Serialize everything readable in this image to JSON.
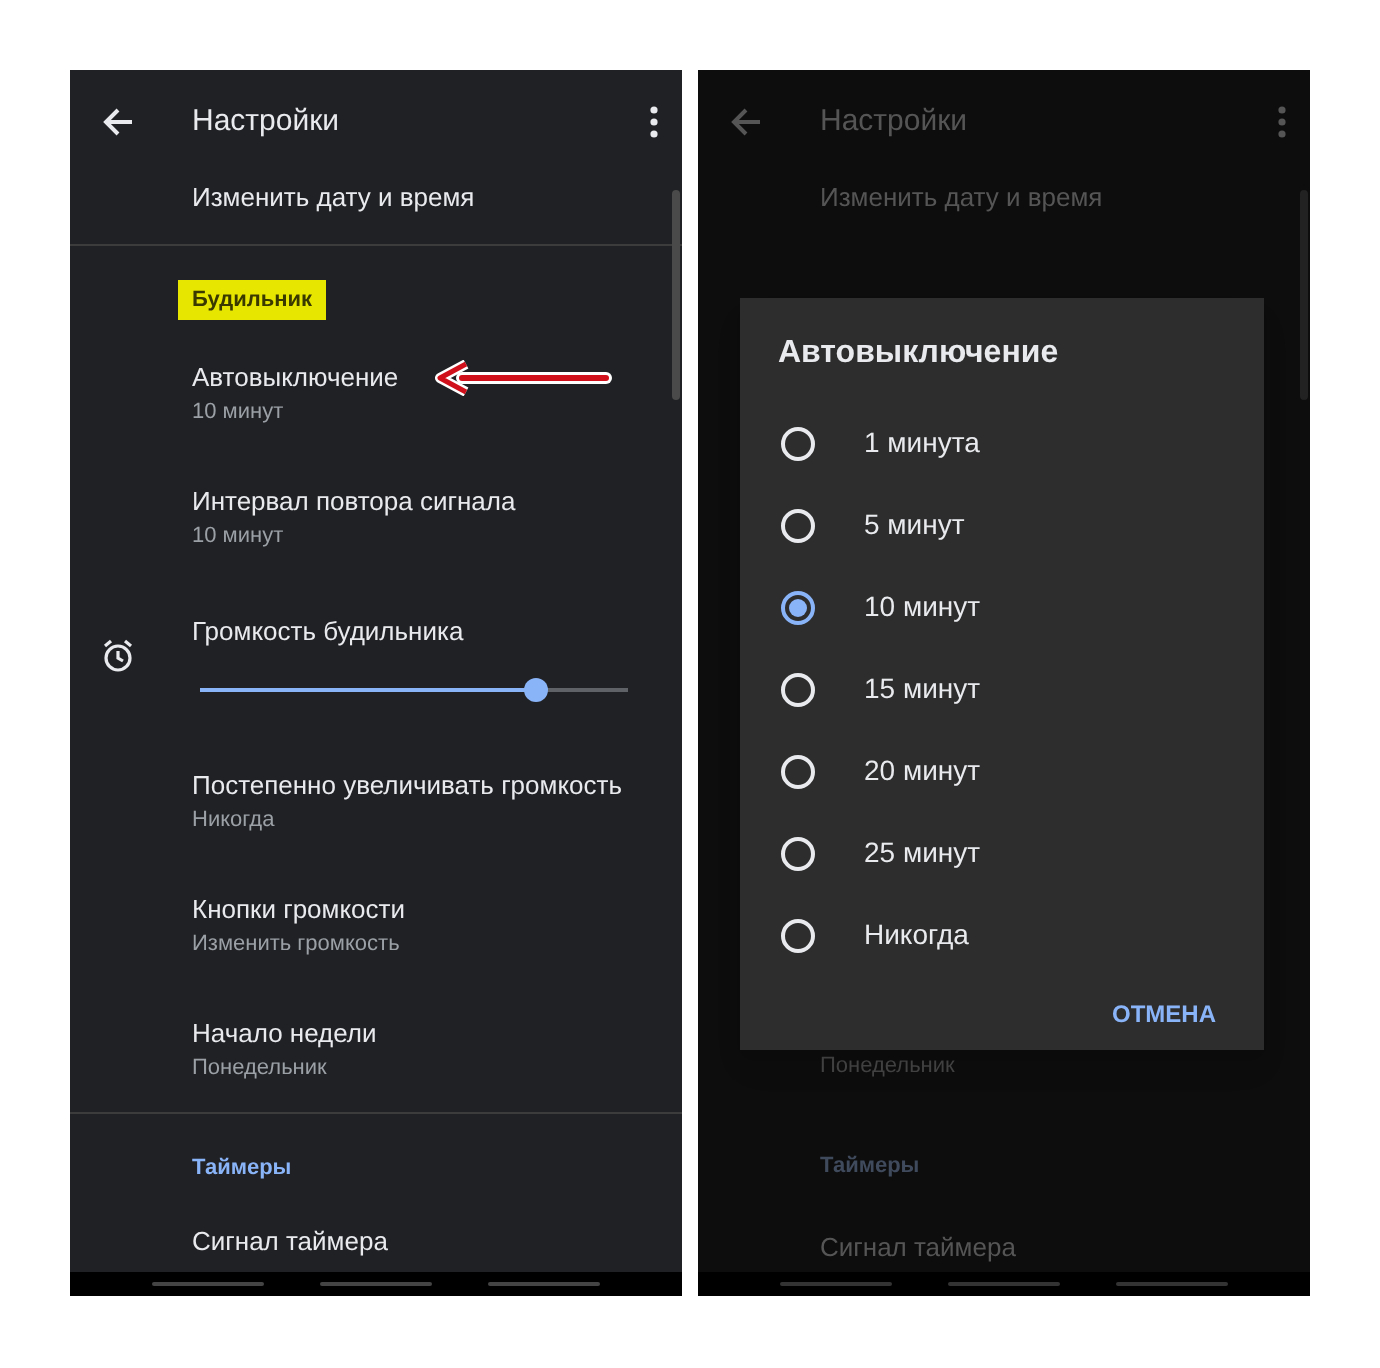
{
  "left_screen": {
    "title": "Настройки",
    "items": [
      {
        "kind": "item",
        "title": "Изменить дату и время"
      },
      {
        "kind": "divider"
      },
      {
        "kind": "category",
        "label": "Будильник",
        "highlighted": true
      },
      {
        "kind": "item",
        "title": "Автовыключение",
        "subtitle": "10 минут",
        "arrow": true
      },
      {
        "kind": "item",
        "title": "Интервал повтора сигнала",
        "subtitle": "10 минут",
        "arrow": false
      },
      {
        "kind": "slider",
        "title": "Громкость будильника",
        "level": 0.785
      },
      {
        "kind": "item",
        "title": "Постепенно увеличивать громкость",
        "subtitle": "Никогда",
        "arrow": false
      },
      {
        "kind": "item",
        "title": "Кнопки громкости",
        "subtitle": "Изменить громкость",
        "arrow": false
      },
      {
        "kind": "item",
        "title": "Начало недели",
        "subtitle": "Понедельник",
        "arrow": false
      },
      {
        "kind": "divider"
      },
      {
        "kind": "category",
        "label": "Таймеры",
        "highlighted": false
      },
      {
        "kind": "item",
        "title": "Сигнал таймера"
      }
    ]
  },
  "right_screen": {
    "title": "Настройки",
    "background": [
      {
        "kind": "item",
        "title": "Изменить дату и время"
      },
      {
        "kind": "subtitle",
        "text": "Понедельник"
      },
      {
        "kind": "category",
        "label": "Таймеры"
      },
      {
        "kind": "item",
        "title": "Сигнал таймера"
      }
    ],
    "dialog": {
      "title": "Автовыключение",
      "options": [
        {
          "label": "1 минута",
          "selected": false
        },
        {
          "label": "5 минут",
          "selected": false
        },
        {
          "label": "10 минут",
          "selected": true
        },
        {
          "label": "15 минут",
          "selected": false
        },
        {
          "label": "20 минут",
          "selected": false
        },
        {
          "label": "25 минут",
          "selected": false
        },
        {
          "label": "Никогда",
          "selected": false
        }
      ],
      "cancel": "ОТМЕНА"
    }
  }
}
